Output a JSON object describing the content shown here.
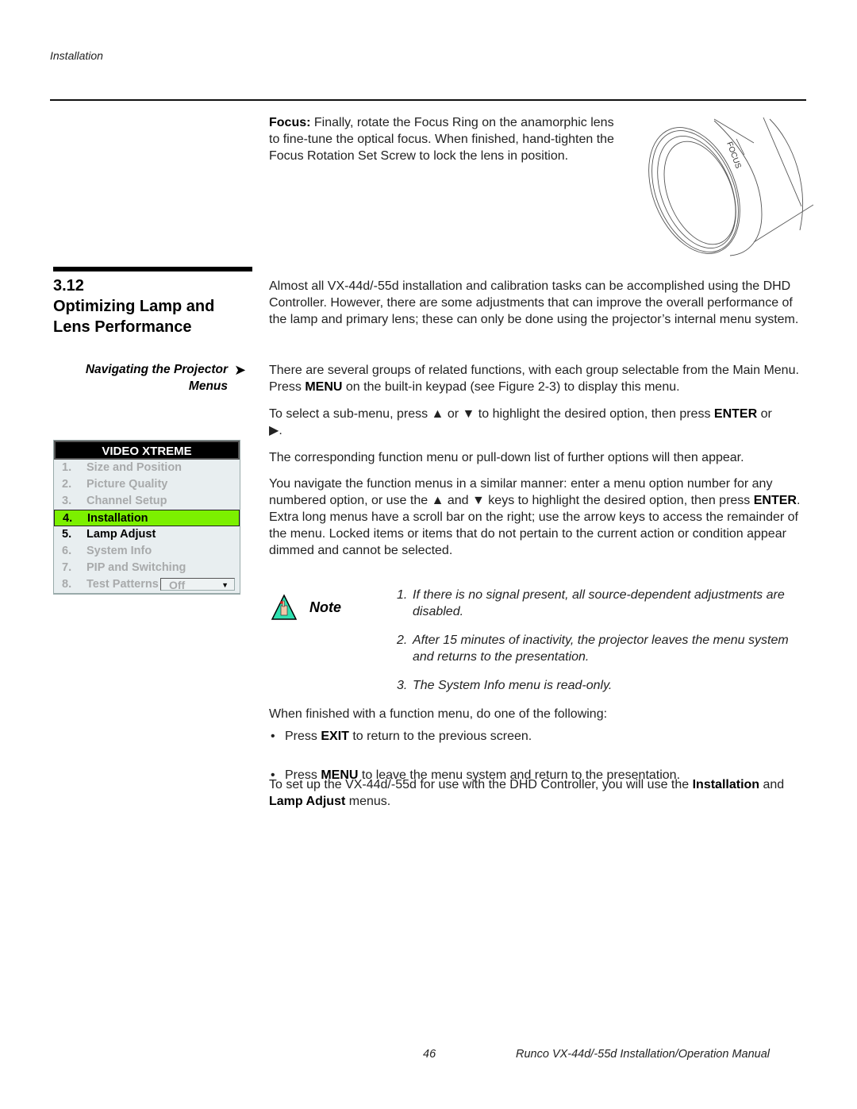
{
  "header": {
    "section_label": "Installation"
  },
  "focus": {
    "label": "Focus:",
    "text": " Finally, rotate the Focus Ring on the anamorphic lens to fine-tune the optical focus. When finished, hand-tighten the Focus Rotation Set Screw to lock the lens in position.",
    "figure_label": "FOCUS"
  },
  "section": {
    "number": "3.12",
    "title": "Optimizing Lamp and Lens Performance",
    "subhead_line1": "Navigating the Projector",
    "subhead_line2": "Menus",
    "subhead_arrow": "➤"
  },
  "menu": {
    "title": "VIDEO XTREME",
    "items": [
      {
        "num": "1.",
        "label": "Size and Position",
        "state": "dimmed"
      },
      {
        "num": "2.",
        "label": "Picture Quality",
        "state": "dimmed"
      },
      {
        "num": "3.",
        "label": "Channel Setup",
        "state": "dimmed"
      },
      {
        "num": "4.",
        "label": "Installation",
        "state": "selected"
      },
      {
        "num": "5.",
        "label": "Lamp Adjust",
        "state": "enabled"
      },
      {
        "num": "6.",
        "label": "System Info",
        "state": "dimmed"
      },
      {
        "num": "7.",
        "label": "PIP and Switching",
        "state": "dimmed"
      },
      {
        "num": "8.",
        "label": "Test Patterns",
        "state": "dimmed",
        "dropdown_value": "Off"
      }
    ],
    "highlight_color": "#7cf000"
  },
  "body": {
    "p1": "Almost all VX-44d/-55d installation and calibration tasks can be accomplished using the DHD Controller. However, there are some adjustments that can improve the overall performance of the lamp and primary lens; these can only be done using the projector’s internal menu system.",
    "p2_a": "There are several groups of related functions, with each group selectable from the Main Menu. Press ",
    "p2_b": "MENU",
    "p2_c": " on the built-in keypad (see Figure 2-3) to display this menu.",
    "p3_a": "To select a sub-menu, press ",
    "p3_up": "▲",
    "p3_b": " or ",
    "p3_down": "▼",
    "p3_c": " to highlight the desired option, then press ",
    "p3_d": "ENTER",
    "p3_e": " or ",
    "p3_right": "▶",
    "p3_f": ".",
    "p4": "The corresponding function menu or pull-down list of further options will then appear.",
    "p5_a": "You navigate the function menus in a similar manner: enter a menu option number for any numbered option, or use the ",
    "p5_up": "▲",
    "p5_b": " and ",
    "p5_down": "▼",
    "p5_c": " keys to highlight the desired option, then press ",
    "p5_d": "ENTER",
    "p5_e": ". Extra long menus have a scroll bar on the right; use the arrow keys to access the remainder of the menu. Locked items or items that do not pertain to the current action or condition appear dimmed and cannot be selected.",
    "note_label": "Note",
    "notes": [
      {
        "n": "1.",
        "text": "If there is no signal present, all source-dependent adjustments are disabled."
      },
      {
        "n": "2.",
        "text": "After 15 minutes of inactivity, the projector leaves the menu system and returns to the presentation."
      },
      {
        "n": "3.",
        "text": "The System Info menu is read-only."
      }
    ],
    "p6": "When finished with a function menu, do one of the following:",
    "bullet1_a": "Press ",
    "bullet1_b": "EXIT",
    "bullet1_c": " to return to the previous screen.",
    "bullet2_a": "Press ",
    "bullet2_b": "MENU",
    "bullet2_c": " to leave the menu system and return to the presentation.",
    "p7_a": "To set up the VX-44d/-55d for use with the DHD Controller, you will use the ",
    "p7_b": "Installation",
    "p7_c": " and ",
    "p7_d": "Lamp Adjust",
    "p7_e": " menus."
  },
  "footer": {
    "page_number": "46",
    "manual_title": "Runco VX-44d/-55d Installation/Operation Manual"
  }
}
